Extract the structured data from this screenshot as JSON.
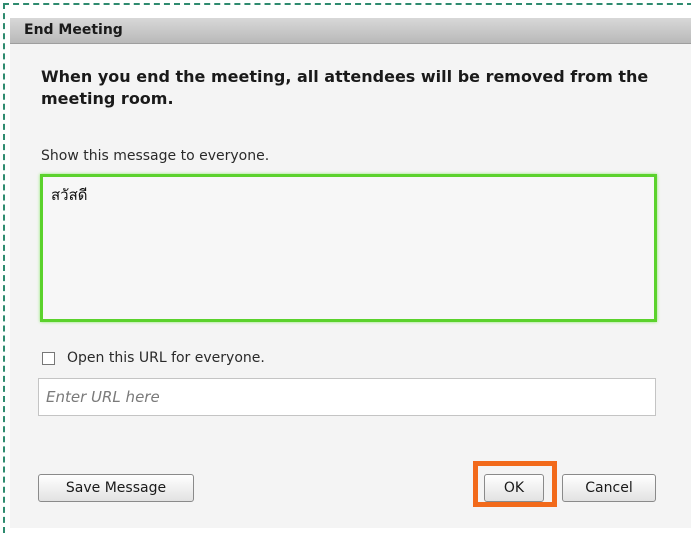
{
  "dialog": {
    "title": "End Meeting",
    "warning": "When you end the meeting, all attendees will be removed from the meeting room.",
    "message_label": "Show this message to everyone.",
    "message_value": "สวัสดี",
    "url_checkbox_label": "Open this URL for everyone.",
    "url_checked": false,
    "url_placeholder": "Enter URL here",
    "buttons": {
      "save": "Save Message",
      "ok": "OK",
      "cancel": "Cancel"
    }
  },
  "colors": {
    "focus_border": "#5bd22c",
    "highlight": "#f26a1b",
    "outline": "#2e8b6f"
  }
}
